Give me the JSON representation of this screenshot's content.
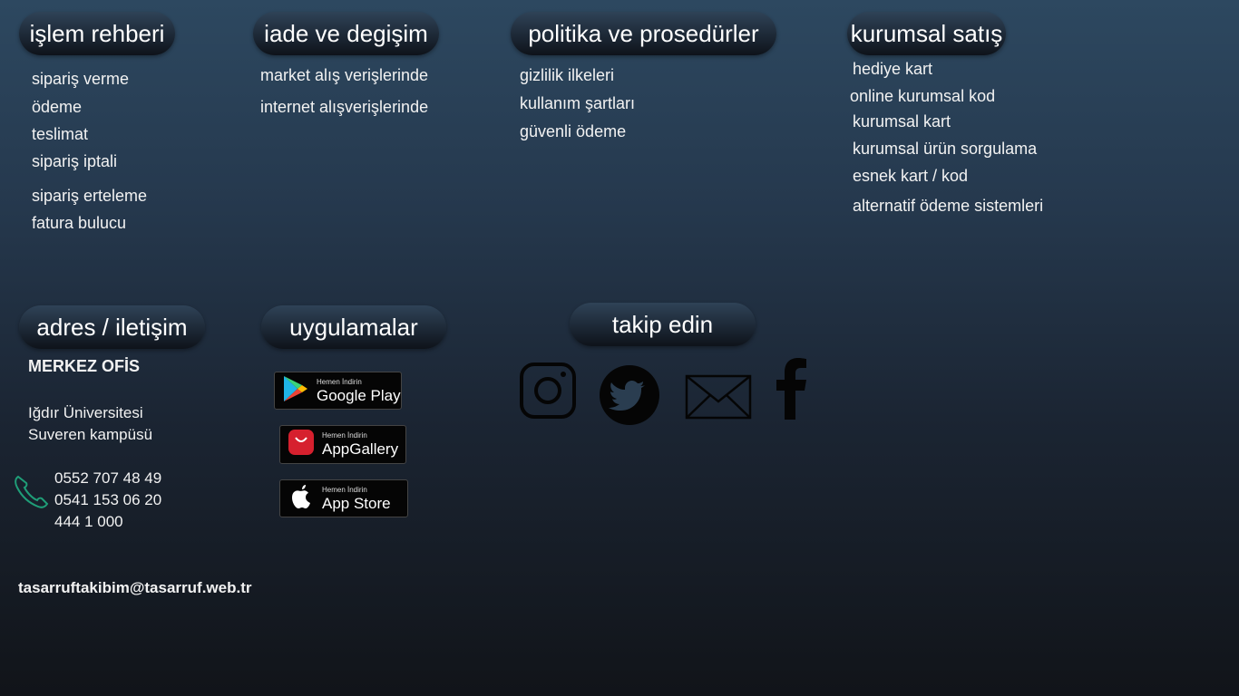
{
  "islem": {
    "title": "işlem rehberi",
    "items": [
      "sipariş verme",
      "ödeme",
      "teslimat",
      "sipariş iptali",
      "sipariş erteleme",
      "fatura bulucu"
    ]
  },
  "iade": {
    "title": "iade ve degişim",
    "items": [
      "market alış verişlerinde",
      "internet alışverişlerinde"
    ]
  },
  "politika": {
    "title": "politika ve prosedürler",
    "items": [
      "gizlilik ilkeleri",
      "kullanım şartları",
      "güvenli ödeme"
    ]
  },
  "kurumsal": {
    "title": "kurumsal satış",
    "items": [
      "hediye kart",
      "online kurumsal kod",
      "kurumsal kart",
      "kurumsal ürün sorgulama",
      "esnek kart / kod",
      "alternatif ödeme sistemleri"
    ]
  },
  "adres": {
    "title": "adres / iletişim",
    "office": "MERKEZ OFİS",
    "address_line1": "Iğdır Üniversitesi",
    "address_line2": "Suveren kampüsü",
    "phones": [
      "0552 707 48 49",
      "0541 153 06 20",
      "444 1 000"
    ],
    "email": "tasarruftakibim@tasarruf.web.tr",
    "phone_icon": "phone-icon",
    "accent": "#1f9e78"
  },
  "uygulamalar": {
    "title": "uygulamalar",
    "badges": [
      {
        "small": "Hemen İndirin",
        "big": "Google Play",
        "icon": "google-play-icon"
      },
      {
        "small": "Hemen İndirin",
        "big": "AppGallery",
        "icon": "huawei-appgallery-icon"
      },
      {
        "small": "Hemen İndirin",
        "big": "App Store",
        "icon": "apple-icon"
      }
    ]
  },
  "takip": {
    "title": "takip edin",
    "icons": [
      "instagram-icon",
      "twitter-icon",
      "mail-icon",
      "facebook-icon"
    ]
  }
}
